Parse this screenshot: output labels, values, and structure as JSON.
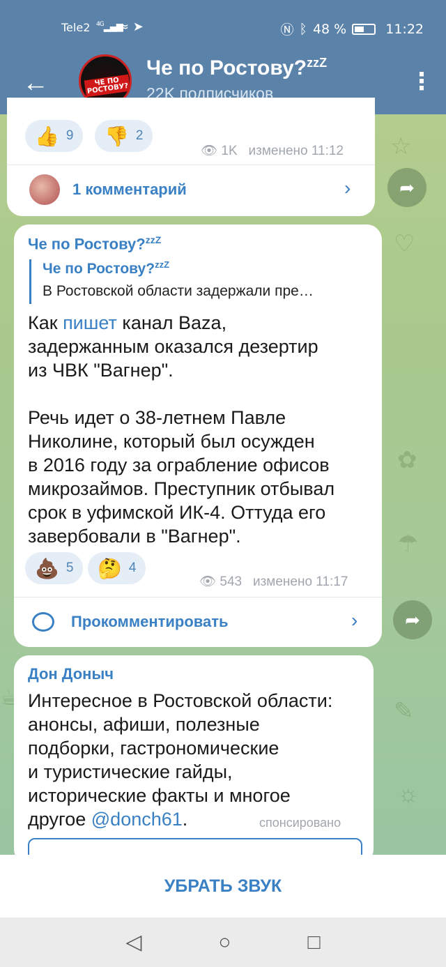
{
  "status_bar": {
    "carrier": "Tele2",
    "signal": "4G",
    "battery": "48 %",
    "time": "11:22"
  },
  "header": {
    "channel_name": "Че по Ростову?",
    "channel_suffix": "zzZ",
    "subscribers": "22K подписчиков",
    "avatar_text": "ЧЕ ПО РОСТОВУ?"
  },
  "post1": {
    "reactions": [
      {
        "emoji": "👍",
        "count": "9"
      },
      {
        "emoji": "👎",
        "count": "2"
      }
    ],
    "views": "1K",
    "edited": "изменено 11:12",
    "comments_label": "1 комментарий"
  },
  "post2": {
    "sender": "Че по Ростову?",
    "sender_suffix": "zzZ",
    "reply_name": "Че по Ростову?",
    "reply_suffix": "zzZ",
    "reply_text": "В Ростовской области задержали пре…",
    "text_part1": "Как ",
    "link_text": "пишет",
    "text_part2": " канал Baza,\nзадержанным оказался дезертир\nиз ЧВК \"Вагнер\".\n\nРечь идет о 38-летнем Павле\nНиколине, который был осужден\nв 2016 году за ограбление офисов\nмикрозаймов. Преступник отбывал\nсрок в уфимской ИК-4. Оттуда его\nзавербовали в \"Вагнер\".",
    "reactions": [
      {
        "emoji": "💩",
        "count": "5"
      },
      {
        "emoji": "🤔",
        "count": "4"
      }
    ],
    "views": "543",
    "edited": "изменено 11:17",
    "comment_label": "Прокомментировать"
  },
  "post3": {
    "sender": "Дон Доныч",
    "text": "Интересное в Ростовской области:\nанонсы, афиши, полезные\nподборки, гастрономические\nи туристические гайды,\nисторические факты и многое\nдругое ",
    "mention": "@donch61",
    "text_end": ".",
    "sponsored": "спонсировано"
  },
  "bottom_action": {
    "label": "УБРАТЬ ЗВУК"
  },
  "nav": {
    "back": "◁",
    "home": "○",
    "recent": "□"
  }
}
